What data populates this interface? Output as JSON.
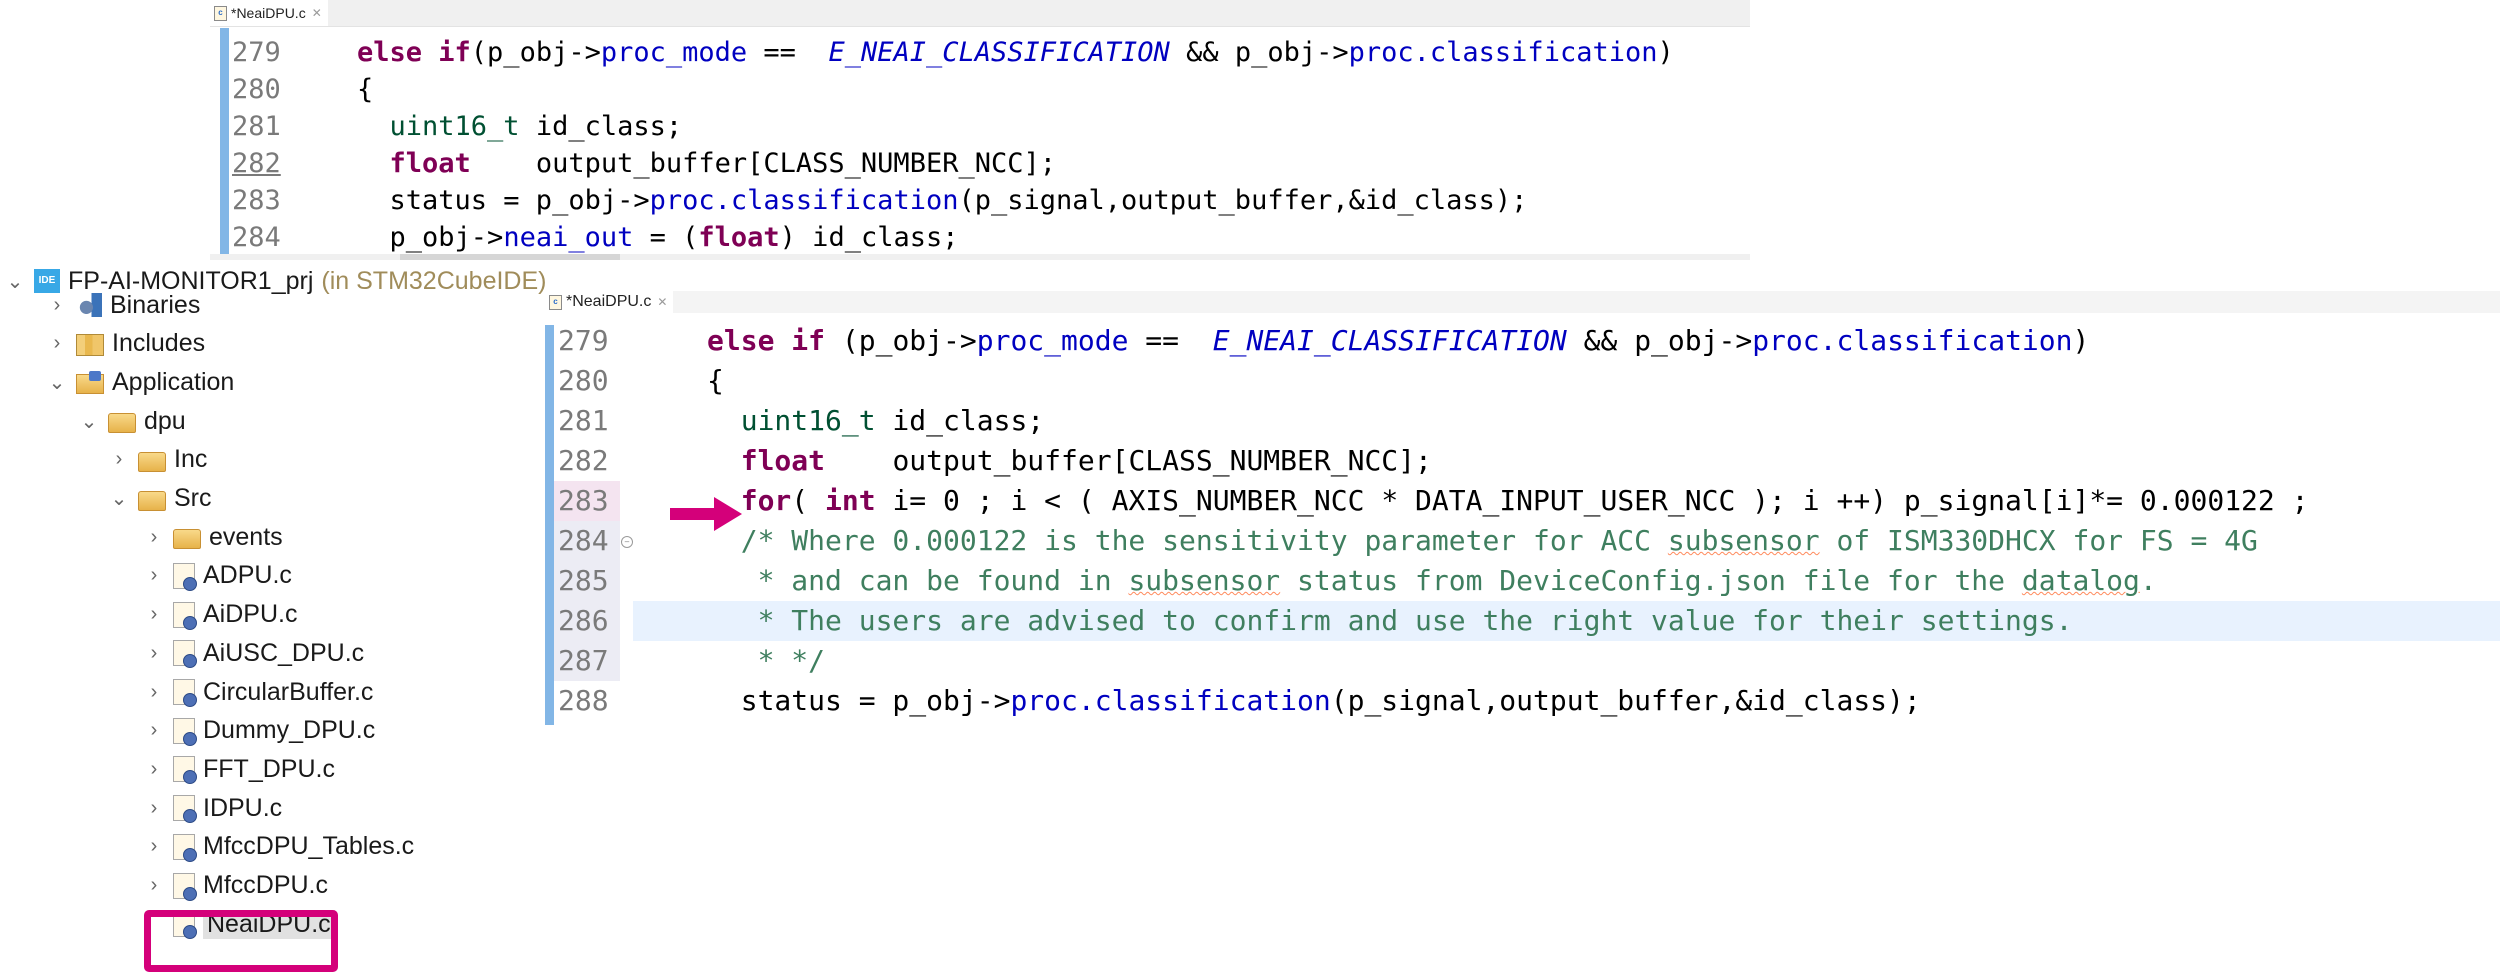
{
  "editor_top": {
    "tab_label": "*NeaiDPU.c",
    "tab_close_icon": "✕",
    "lines": [
      {
        "num": "279",
        "tokens": [
          [
            "kw",
            "else if"
          ],
          [
            "",
            "(p_obj->"
          ],
          [
            "field",
            "proc_mode"
          ],
          [
            "",
            " ==  "
          ],
          [
            "enum",
            "E_NEAI_CLASSIFICATION"
          ],
          [
            "",
            " && p_obj->"
          ],
          [
            "field",
            "proc.classification"
          ],
          [
            "",
            ")"
          ]
        ]
      },
      {
        "num": "280",
        "tokens": [
          [
            "",
            "{"
          ]
        ]
      },
      {
        "num": "281",
        "tokens": [
          [
            "",
            "  "
          ],
          [
            "type",
            "uint16_t"
          ],
          [
            "",
            " id_class;"
          ]
        ]
      },
      {
        "num": "282",
        "tokens": [
          [
            "",
            "  "
          ],
          [
            "kw",
            "float"
          ],
          [
            "",
            "    output_buffer[CLASS_NUMBER_NCC];"
          ]
        ]
      },
      {
        "num": "283",
        "tokens": [
          [
            "",
            "  status = p_obj->"
          ],
          [
            "field",
            "proc.classification"
          ],
          [
            "",
            "(p_signal,output_buffer,&id_class);"
          ]
        ]
      },
      {
        "num": "284",
        "tokens": [
          [
            "",
            "  p_obj->"
          ],
          [
            "field",
            "neai_out"
          ],
          [
            "",
            " = ("
          ],
          [
            "kw",
            "float"
          ],
          [
            "",
            ") id_class;"
          ]
        ]
      }
    ]
  },
  "project_tree": {
    "project_name": "FP-AI-MONITOR1_prj",
    "project_suffix": "(in STM32CubeIDE)",
    "items": [
      {
        "label": "Binaries",
        "icon": "binaries-icon",
        "level": 1,
        "chevron": "›"
      },
      {
        "label": "Includes",
        "icon": "includes-icon",
        "level": 1,
        "chevron": "›"
      },
      {
        "label": "Application",
        "icon": "application-folder-icon",
        "level": 1,
        "chevron": "⌄"
      },
      {
        "label": "dpu",
        "icon": "folder-icon",
        "level": 2,
        "chevron": "⌄"
      },
      {
        "label": "Inc",
        "icon": "folder-icon",
        "level": 3,
        "chevron": "›"
      },
      {
        "label": "Src",
        "icon": "folder-icon",
        "level": 3,
        "chevron": "⌄"
      },
      {
        "label": "events",
        "icon": "folder-icon",
        "level": 4,
        "chevron": "›"
      },
      {
        "label": "ADPU.c",
        "icon": "c-file-icon",
        "level": 4,
        "chevron": "›"
      },
      {
        "label": "AiDPU.c",
        "icon": "c-file-icon",
        "level": 4,
        "chevron": "›"
      },
      {
        "label": "AiUSC_DPU.c",
        "icon": "c-file-icon",
        "level": 4,
        "chevron": "›"
      },
      {
        "label": "CircularBuffer.c",
        "icon": "c-file-icon",
        "level": 4,
        "chevron": "›"
      },
      {
        "label": "Dummy_DPU.c",
        "icon": "c-file-icon",
        "level": 4,
        "chevron": "›"
      },
      {
        "label": "FFT_DPU.c",
        "icon": "c-file-icon",
        "level": 4,
        "chevron": "›"
      },
      {
        "label": "IDPU.c",
        "icon": "c-file-icon",
        "level": 4,
        "chevron": "›"
      },
      {
        "label": "MfccDPU_Tables.c",
        "icon": "c-file-icon",
        "level": 4,
        "chevron": "›"
      },
      {
        "label": "MfccDPU.c",
        "icon": "c-file-icon",
        "level": 4,
        "chevron": "›"
      },
      {
        "label": "NeaiDPU.c",
        "icon": "c-file-icon",
        "level": 4,
        "chevron": "",
        "selected": true
      }
    ]
  },
  "editor_bottom": {
    "tab_label": "*NeaiDPU.c",
    "tab_close_icon": "✕",
    "lines": [
      {
        "num": "279",
        "tokens": [
          [
            "kw",
            "else if"
          ],
          [
            "",
            " (p_obj->"
          ],
          [
            "field",
            "proc_mode"
          ],
          [
            "",
            " ==  "
          ],
          [
            "enum",
            "E_NEAI_CLASSIFICATION"
          ],
          [
            "",
            " && p_obj->"
          ],
          [
            "field",
            "proc.classification"
          ],
          [
            "",
            ")"
          ]
        ]
      },
      {
        "num": "280",
        "tokens": [
          [
            "",
            "{"
          ]
        ]
      },
      {
        "num": "281",
        "tokens": [
          [
            "",
            "  "
          ],
          [
            "type",
            "uint16_t"
          ],
          [
            "",
            " id_class;"
          ]
        ]
      },
      {
        "num": "282",
        "tokens": [
          [
            "",
            "  "
          ],
          [
            "kw",
            "float"
          ],
          [
            "",
            "    output_buffer[CLASS_NUMBER_NCC];"
          ]
        ]
      },
      {
        "num": "283",
        "tokens": [
          [
            "",
            "  "
          ],
          [
            "kw",
            "for"
          ],
          [
            "",
            "( "
          ],
          [
            "kw",
            "int"
          ],
          [
            "",
            " i= 0 ; i < ( AXIS_NUMBER_NCC * DATA_INPUT_USER_NCC ); i ++) p_signal[i]*= 0.000122 ;"
          ]
        ]
      },
      {
        "num": "284",
        "tokens": [
          [
            "cmt",
            "  /* Where 0.000122 is the sensitivity parameter for ACC "
          ],
          [
            "cmt squig",
            "subsensor"
          ],
          [
            "cmt",
            " of ISM330DHCX for FS = 4G"
          ]
        ]
      },
      {
        "num": "285",
        "tokens": [
          [
            "cmt",
            "   * and can be found in "
          ],
          [
            "cmt squig",
            "subsensor"
          ],
          [
            "cmt",
            " status from DeviceConfig.json file for the "
          ],
          [
            "cmt squig",
            "datalog"
          ],
          [
            "cmt",
            "."
          ]
        ]
      },
      {
        "num": "286",
        "tokens": [
          [
            "cmt",
            "   * The users are advised to confirm and use the right value for their settings."
          ]
        ]
      },
      {
        "num": "287",
        "tokens": [
          [
            "cmt",
            "   * */"
          ]
        ]
      },
      {
        "num": "288",
        "tokens": [
          [
            "",
            "  status = p_obj->"
          ],
          [
            "field",
            "proc.classification"
          ],
          [
            "",
            "(p_signal,output_buffer,&id_class);"
          ]
        ]
      }
    ]
  },
  "annotations": {
    "accent_color": "#d4007a",
    "arrow_points_to_line": "283",
    "highlighted_file": "NeaiDPU.c"
  }
}
